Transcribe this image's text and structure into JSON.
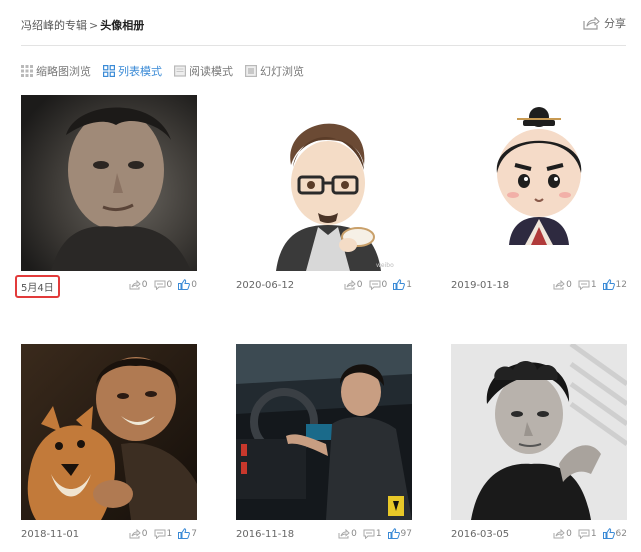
{
  "breadcrumb": {
    "album_owner": "冯绍峰的专辑",
    "separator": ">",
    "current": "头像相册"
  },
  "share_label": "分享",
  "view_modes": [
    {
      "label": "缩略图浏览",
      "icon": "grid-icon",
      "active": false
    },
    {
      "label": "列表模式",
      "icon": "list-icon",
      "active": true
    },
    {
      "label": "阅读模式",
      "icon": "book-icon",
      "active": false
    },
    {
      "label": "幻灯浏览",
      "icon": "slideshow-icon",
      "active": false
    }
  ],
  "photos": [
    {
      "date": "5月4日",
      "forward": "0",
      "comment": "0",
      "like": "0",
      "highlighted": true,
      "subject": "portrait-dark"
    },
    {
      "date": "2020-06-12",
      "forward": "0",
      "comment": "0",
      "like": "1",
      "highlighted": false,
      "subject": "cartoon-glasses-tea"
    },
    {
      "date": "2019-01-18",
      "forward": "0",
      "comment": "1",
      "like": "12",
      "highlighted": false,
      "subject": "cartoon-topknot"
    },
    {
      "date": "2018-11-01",
      "forward": "0",
      "comment": "1",
      "like": "7",
      "highlighted": false,
      "subject": "man-with-fox"
    },
    {
      "date": "2016-11-18",
      "forward": "0",
      "comment": "1",
      "like": "97",
      "highlighted": false,
      "subject": "man-in-car"
    },
    {
      "date": "2016-03-05",
      "forward": "0",
      "comment": "1",
      "like": "62",
      "highlighted": false,
      "subject": "bw-portrait"
    }
  ],
  "colors": {
    "accent": "#3a8ad6",
    "highlight_border": "#e23b3b",
    "divider": "#e3e3e3",
    "like_icon": "#3a8ad6"
  }
}
